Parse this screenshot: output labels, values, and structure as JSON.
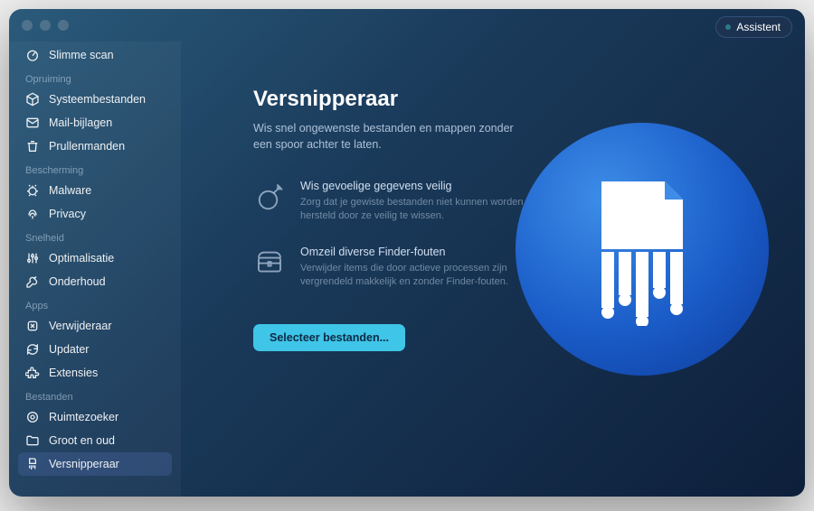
{
  "header": {
    "assistant_label": "Assistent"
  },
  "sidebar": {
    "smart_scan_label": "Slimme scan",
    "sections": [
      {
        "title": "Opruiming",
        "items": [
          {
            "icon": "cube-icon",
            "label": "Systeembestanden"
          },
          {
            "icon": "mail-icon",
            "label": "Mail-bijlagen"
          },
          {
            "icon": "trash-icon",
            "label": "Prullenmanden"
          }
        ]
      },
      {
        "title": "Bescherming",
        "items": [
          {
            "icon": "bug-icon",
            "label": "Malware"
          },
          {
            "icon": "fingerprint-icon",
            "label": "Privacy"
          }
        ]
      },
      {
        "title": "Snelheid",
        "items": [
          {
            "icon": "sliders-icon",
            "label": "Optimalisatie"
          },
          {
            "icon": "wrench-icon",
            "label": "Onderhoud"
          }
        ]
      },
      {
        "title": "Apps",
        "items": [
          {
            "icon": "uninstall-icon",
            "label": "Verwijderaar"
          },
          {
            "icon": "update-icon",
            "label": "Updater"
          },
          {
            "icon": "puzzle-icon",
            "label": "Extensies"
          }
        ]
      },
      {
        "title": "Bestanden",
        "items": [
          {
            "icon": "lens-icon",
            "label": "Ruimtezoeker"
          },
          {
            "icon": "folder-icon",
            "label": "Groot en oud"
          },
          {
            "icon": "shredder-icon",
            "label": "Versnipperaar",
            "active": true
          }
        ]
      }
    ]
  },
  "main": {
    "title": "Versnipperaar",
    "subtitle": "Wis snel ongewenste bestanden en mappen zonder een spoor achter te laten.",
    "features": [
      {
        "title": "Wis gevoelige gegevens veilig",
        "desc": "Zorg dat je gewiste bestanden niet kunnen worden hersteld door ze veilig te wissen."
      },
      {
        "title": "Omzeil diverse Finder-fouten",
        "desc": "Verwijder items die door actieve processen zijn vergrendeld makkelijk en zonder Finder-fouten."
      }
    ],
    "cta_label": "Selecteer bestanden..."
  }
}
